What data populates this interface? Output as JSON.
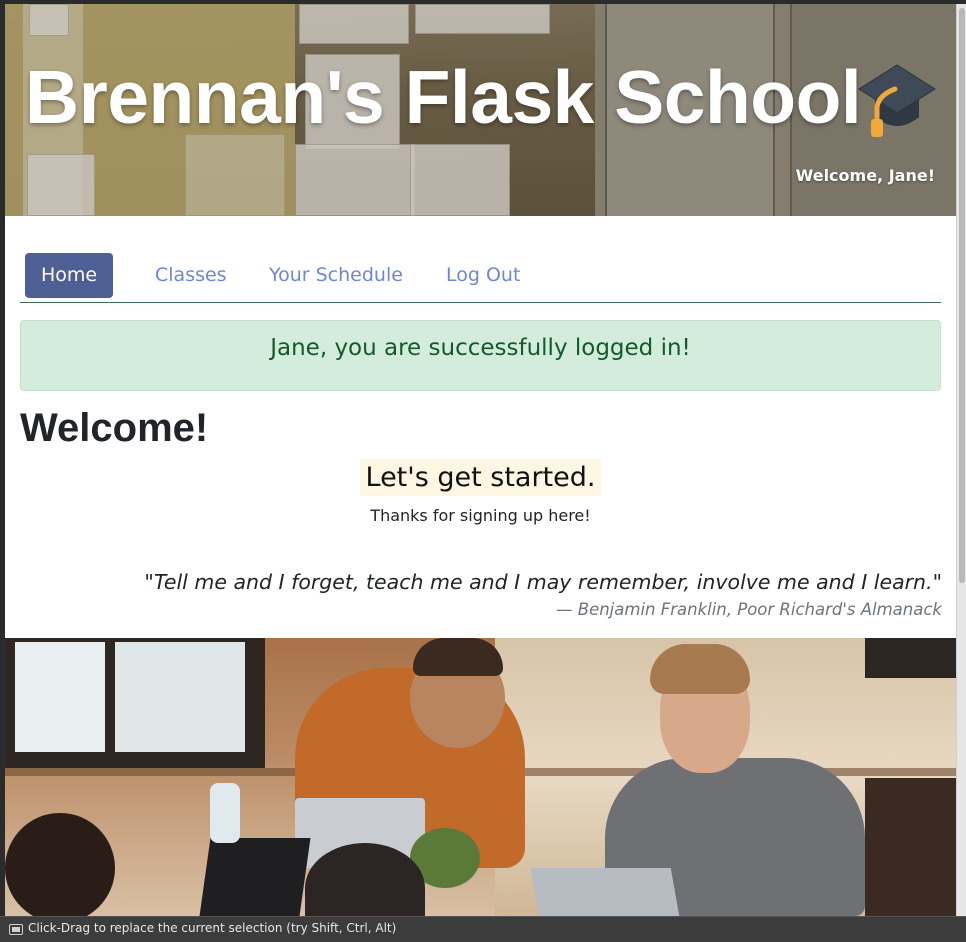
{
  "header": {
    "title": "Brennan's Flask School",
    "welcome_user": "Welcome, Jane!",
    "logo_icon": "graduation-cap-icon"
  },
  "nav": {
    "items": [
      {
        "label": "Home",
        "active": true
      },
      {
        "label": "Classes",
        "active": false
      },
      {
        "label": "Your Schedule",
        "active": false
      },
      {
        "label": "Log Out",
        "active": false
      }
    ]
  },
  "alert": {
    "message": "Jane, you are successfully logged in!"
  },
  "main": {
    "heading": "Welcome!",
    "lead": "Let's get started.",
    "sub": "Thanks for signing up here!",
    "quote": "\"Tell me and I forget, teach me and I may remember, involve me and I learn.\"",
    "quote_source": "— Benjamin Franklin, Poor Richard's Almanack"
  },
  "status_bar": {
    "text": "Click-Drag to replace the current selection (try Shift, Ctrl, Alt)"
  },
  "colors": {
    "nav_active": "#4e5f96",
    "nav_link": "#6f86d6",
    "alert_bg": "#d4ecdb",
    "alert_text": "#145a2a"
  }
}
